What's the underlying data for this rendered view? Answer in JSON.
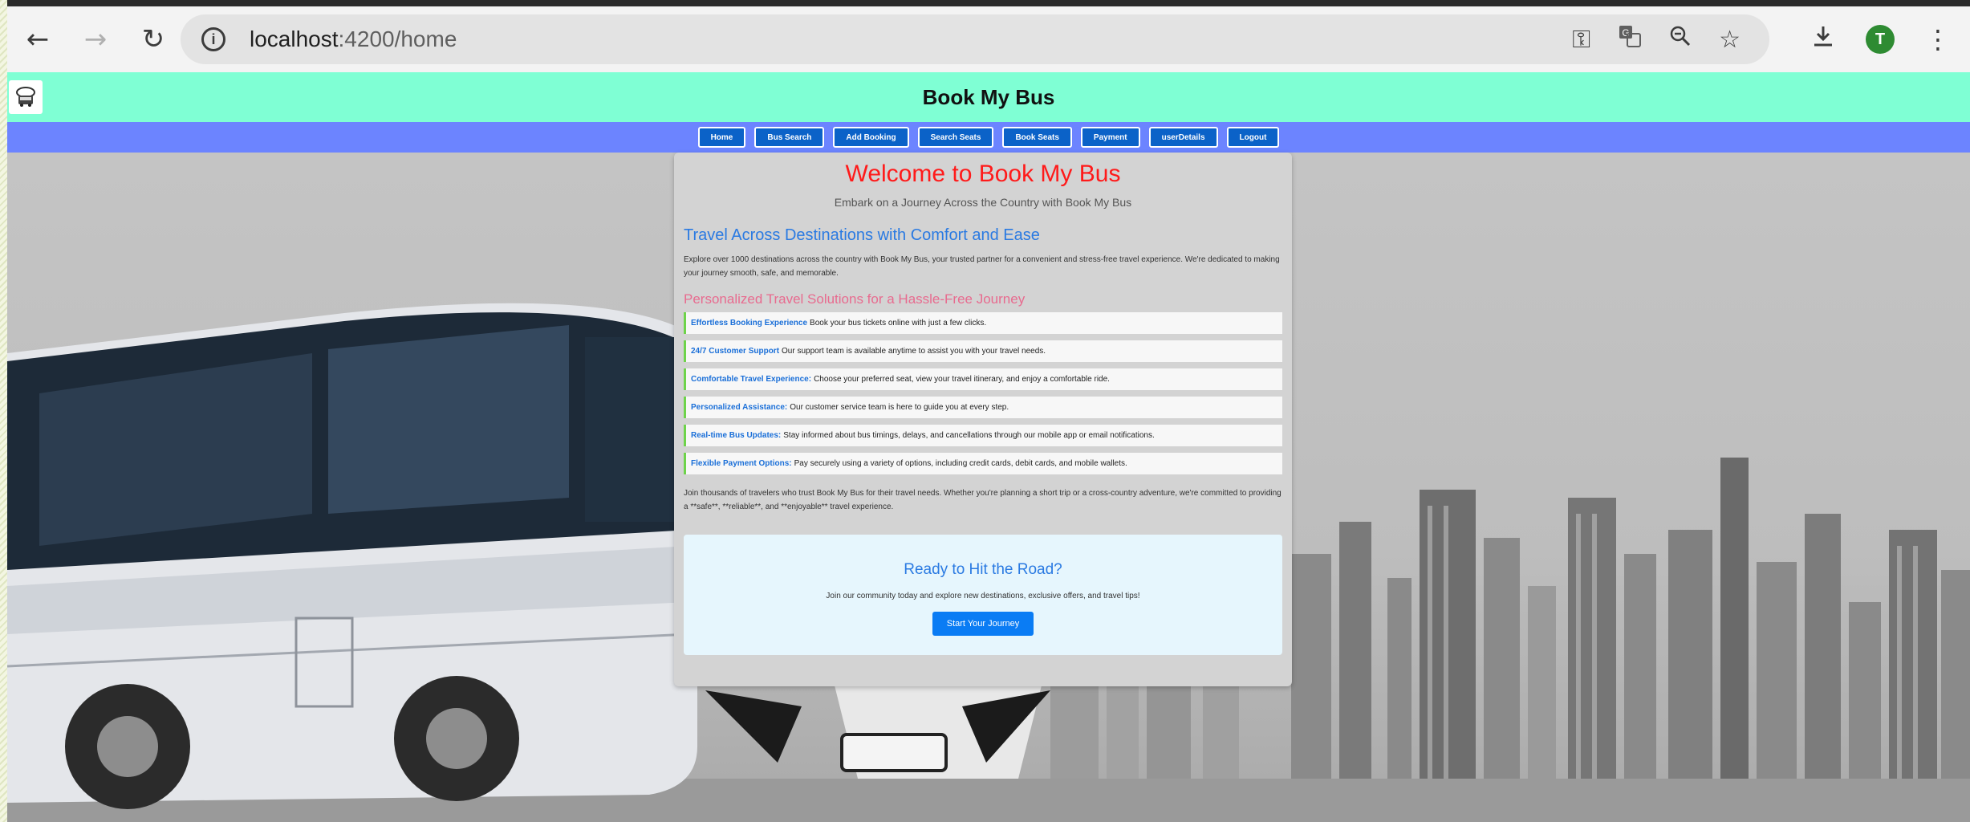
{
  "browser": {
    "url_host": "localhost",
    "url_path": ":4200/home",
    "profile_initial": "T",
    "icons": {
      "back": "back-arrow-icon",
      "forward": "forward-arrow-icon",
      "reload": "reload-icon",
      "site_info": "info-icon",
      "password": "key-icon",
      "translate": "translate-icon",
      "zoom": "zoom-icon",
      "bookmark": "star-icon",
      "download": "download-icon",
      "menu": "kebab-menu-icon"
    }
  },
  "header": {
    "title": "Book My Bus",
    "logo_icon": "bus-logo-icon"
  },
  "nav": {
    "items": [
      "Home",
      "Bus Search",
      "Add Booking",
      "Search Seats",
      "Book Seats",
      "Payment",
      "userDetails",
      "Logout"
    ]
  },
  "main": {
    "welcome": "Welcome to Book My Bus",
    "tagline": "Embark on a Journey Across the Country with Book My Bus",
    "section1_title": "Travel Across Destinations with Comfort and Ease",
    "section1_text": "Explore over 1000 destinations across the country with Book My Bus, your trusted partner for a convenient and stress-free travel experience. We're dedicated to making your journey smooth, safe, and memorable.",
    "section2_title": "Personalized Travel Solutions for a Hassle-Free Journey",
    "features": [
      {
        "title": "Effortless Booking Experience",
        "text": "Book your bus tickets online with just a few clicks."
      },
      {
        "title": "24/7 Customer Support",
        "text": "Our support team is available anytime to assist you with your travel needs."
      },
      {
        "title": "Comfortable Travel Experience:",
        "text": "Choose your preferred seat, view your travel itinerary, and enjoy a comfortable ride."
      },
      {
        "title": "Personalized Assistance:",
        "text": "Our customer service team is here to guide you at every step."
      },
      {
        "title": "Real-time Bus Updates:",
        "text": "Stay informed about bus timings, delays, and cancellations through our mobile app or email notifications."
      },
      {
        "title": "Flexible Payment Options:",
        "text": "Pay securely using a variety of options, including credit cards, debit cards, and mobile wallets."
      }
    ],
    "closing_text": "Join thousands of travelers who trust Book My Bus for their travel needs. Whether you're planning a short trip or a cross-country adventure, we're committed to providing a **safe**, **reliable**, and **enjoyable** travel experience.",
    "cta": {
      "title": "Ready to Hit the Road?",
      "text": "Join our community today and explore new destinations, exclusive offers, and travel tips!",
      "button": "Start Your Journey"
    }
  },
  "colors": {
    "header_bg": "#7fffd4",
    "nav_bg": "#6c84ff",
    "nav_button": "#0b62c8",
    "welcome": "#ff1a1a",
    "section_heading": "#2a7ae2",
    "section_heading_alt": "#e86b8f",
    "feature_border": "#6ed34a",
    "cta_button": "#0a7cf4"
  }
}
